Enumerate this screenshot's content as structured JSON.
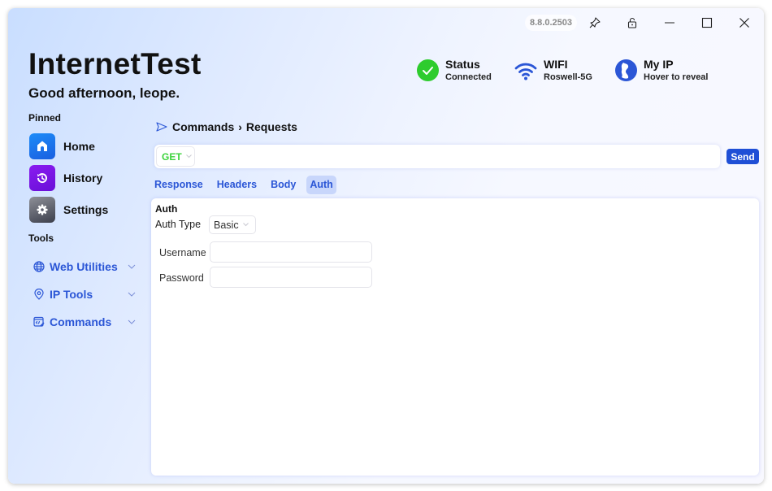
{
  "window": {
    "version": "8.8.0.2503",
    "controls": [
      "pin-icon",
      "lock-icon",
      "minimize-icon",
      "maximize-icon",
      "close-icon"
    ]
  },
  "header": {
    "app_title": "InternetTest",
    "greeting": "Good afternoon, leope.",
    "stats": [
      {
        "icon": "check-circle-icon",
        "title": "Status",
        "subtitle": "Connected",
        "color": "#2ecc2e"
      },
      {
        "icon": "wifi-icon",
        "title": "WIFI",
        "subtitle": "Roswell-5G",
        "color": "#2b56d6"
      },
      {
        "icon": "globe-icon",
        "title": "My IP",
        "subtitle": "Hover to reveal",
        "color": "#2b56d6"
      }
    ]
  },
  "sidebar": {
    "pinned_label": "Pinned",
    "pinned": [
      {
        "label": "Home",
        "icon": "home-icon",
        "color": "#1a6fef"
      },
      {
        "label": "History",
        "icon": "history-icon",
        "color": "#7a16e6"
      },
      {
        "label": "Settings",
        "icon": "gear-icon",
        "color": "#5c5f6e"
      }
    ],
    "tools_label": "Tools",
    "tools": [
      {
        "label": "Web Utilities",
        "icon": "globe-icon"
      },
      {
        "label": "IP Tools",
        "icon": "location-pin-icon"
      },
      {
        "label": "Commands",
        "icon": "code-window-icon"
      }
    ]
  },
  "main": {
    "breadcrumb": {
      "parent": "Commands",
      "separator": "›",
      "current": "Requests"
    },
    "method": "GET",
    "url_value": "",
    "send_label": "Send",
    "tabs": [
      {
        "label": "Response",
        "active": false
      },
      {
        "label": "Headers",
        "active": false
      },
      {
        "label": "Body",
        "active": false
      },
      {
        "label": "Auth",
        "active": true
      }
    ],
    "auth": {
      "title": "Auth",
      "type_label": "Auth Type",
      "type_value": "Basic",
      "username_label": "Username",
      "username_value": "",
      "password_label": "Password",
      "password_value": ""
    }
  },
  "colors": {
    "accent": "#2b56d6",
    "send_button": "#1f4fd6",
    "method_get": "#3bd33b",
    "active_tab_bg": "#c8d6fb"
  }
}
